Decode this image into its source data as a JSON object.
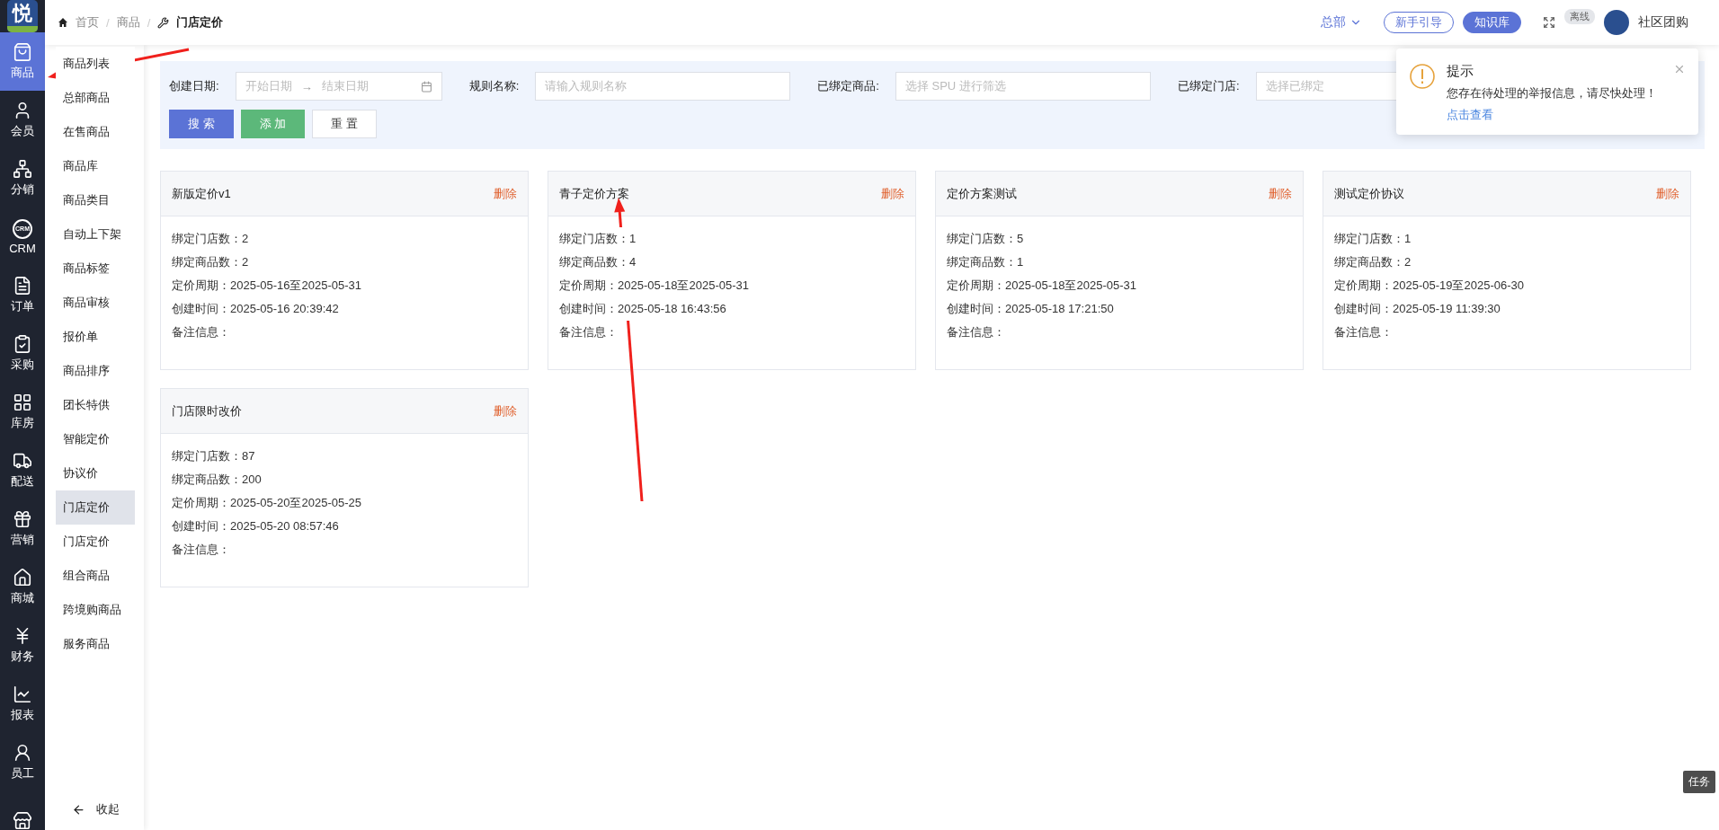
{
  "logo": {
    "text": "悦"
  },
  "nav": [
    {
      "kind": "bag",
      "label": "商品",
      "selected": true
    },
    {
      "kind": "user",
      "label": "会员",
      "selected": false
    },
    {
      "kind": "network",
      "label": "分销",
      "selected": false
    },
    {
      "kind": "crm",
      "icon_text": "CRM",
      "label": "CRM",
      "selected": false
    },
    {
      "kind": "file",
      "label": "订单",
      "selected": false
    },
    {
      "kind": "clipboard",
      "label": "采购",
      "selected": false
    },
    {
      "kind": "grid",
      "label": "库房",
      "selected": false
    },
    {
      "kind": "truck",
      "label": "配送",
      "selected": false
    },
    {
      "kind": "gift",
      "label": "营销",
      "selected": false
    },
    {
      "kind": "home",
      "label": "商城",
      "selected": false
    },
    {
      "kind": "yen",
      "label": "财务",
      "selected": false
    },
    {
      "kind": "chart",
      "label": "报表",
      "selected": false
    },
    {
      "kind": "staff",
      "label": "员工",
      "selected": false
    },
    {
      "kind": "store",
      "selected": false
    }
  ],
  "breadcrumb_separator": "/",
  "breadcrumb": [
    {
      "kind": "home",
      "label": "首页"
    },
    {
      "kind": "plain",
      "label": "商品"
    },
    {
      "kind": "tool",
      "label": "门店定价"
    }
  ],
  "submenu": {
    "items": [
      {
        "label": "商品列表",
        "selected": false
      },
      {
        "label": "总部商品",
        "selected": false
      },
      {
        "label": "在售商品",
        "selected": false
      },
      {
        "label": "商品库",
        "selected": false
      },
      {
        "label": "商品类目",
        "selected": false
      },
      {
        "label": "自动上下架",
        "selected": false
      },
      {
        "label": "商品标签",
        "selected": false
      },
      {
        "label": "商品审核",
        "selected": false
      },
      {
        "label": "报价单",
        "selected": false
      },
      {
        "label": "商品排序",
        "selected": false
      },
      {
        "label": "团长特供",
        "selected": false
      },
      {
        "label": "智能定价",
        "selected": false
      },
      {
        "label": "协议价",
        "selected": false
      },
      {
        "label": "门店定价",
        "selected": true
      },
      {
        "label": "门店定价",
        "selected": false
      },
      {
        "label": "组合商品",
        "selected": false
      },
      {
        "label": "跨境购商品",
        "selected": false
      },
      {
        "label": "服务商品",
        "selected": false
      }
    ],
    "collapse": "收起"
  },
  "header": {
    "org": "总部",
    "guide": "新手引导",
    "kb": "知识库",
    "offline": "离线",
    "user": "社区团购"
  },
  "filters": {
    "date_label": "创建日期:",
    "start_placeholder": "开始日期",
    "range_separator": "→",
    "end_placeholder": "结束日期",
    "name_label": "规则名称:",
    "name_placeholder": "请输入规则名称",
    "goods_label": "已绑定商品:",
    "goods_placeholder": "选择 SPU 进行筛选",
    "store_label": "已绑定门店:",
    "store_placeholder": "选择已绑定"
  },
  "buttons": [
    {
      "kind": "primary",
      "label": "搜 索"
    },
    {
      "kind": "success",
      "label": "添 加"
    },
    {
      "kind": "default",
      "label": "重 置"
    }
  ],
  "cards": [
    {
      "title": "新版定价v1",
      "delete": "删除",
      "lines": [
        "绑定门店数：2",
        "绑定商品数：2",
        "定价周期：2025-05-16至2025-05-31",
        "创建时间：2025-05-16 20:39:42",
        "备注信息："
      ]
    },
    {
      "title": "青子定价方案",
      "delete": "删除",
      "lines": [
        "绑定门店数：1",
        "绑定商品数：4",
        "定价周期：2025-05-18至2025-05-31",
        "创建时间：2025-05-18 16:43:56",
        "备注信息："
      ]
    },
    {
      "title": "定价方案测试",
      "delete": "删除",
      "lines": [
        "绑定门店数：5",
        "绑定商品数：1",
        "定价周期：2025-05-18至2025-05-31",
        "创建时间：2025-05-18 17:21:50",
        "备注信息："
      ]
    },
    {
      "title": "测试定价协议",
      "delete": "删除",
      "lines": [
        "绑定门店数：1",
        "绑定商品数：2",
        "定价周期：2025-05-19至2025-06-30",
        "创建时间：2025-05-19 11:39:30",
        "备注信息："
      ]
    },
    {
      "title": "门店限时改价",
      "delete": "删除",
      "lines": [
        "绑定门店数：87",
        "绑定商品数：200",
        "定价周期：2025-05-20至2025-05-25",
        "创建时间：2025-05-20 08:57:46",
        "备注信息："
      ]
    }
  ],
  "notification": {
    "title": "提示",
    "message": "您存在待处理的举报信息，请尽快处理！",
    "link": "点击查看"
  },
  "task_tab": "任务"
}
